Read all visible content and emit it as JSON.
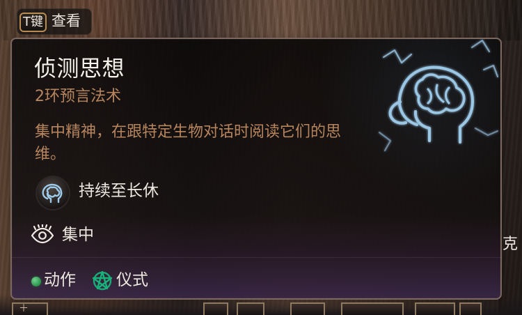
{
  "inspect_hint": {
    "key_label": "T键",
    "action_label": "查看"
  },
  "tooltip": {
    "spell_name": "侦测思想",
    "subtitle": "2环预言法术",
    "description": "集中精神，在跟特定生物对话时阅读它们的思维。",
    "duration_text": "持续至长休",
    "concentration_text": "集中",
    "action_text": "动作",
    "ritual_text": "仪式"
  },
  "side_text": "克",
  "colors": {
    "title": "#f4f1ea",
    "accent": "#b7855d",
    "spell_glow": "#9ecbea",
    "ritual_green": "#18b37b",
    "action_green": "#2ca356",
    "panel_border": "#7d6860"
  },
  "icons": {
    "spell": "brain-head-icon",
    "duration": "brain-head-small-icon",
    "concentration": "eye-icon",
    "action": "action-dot-icon",
    "ritual": "pentagram-icon"
  }
}
